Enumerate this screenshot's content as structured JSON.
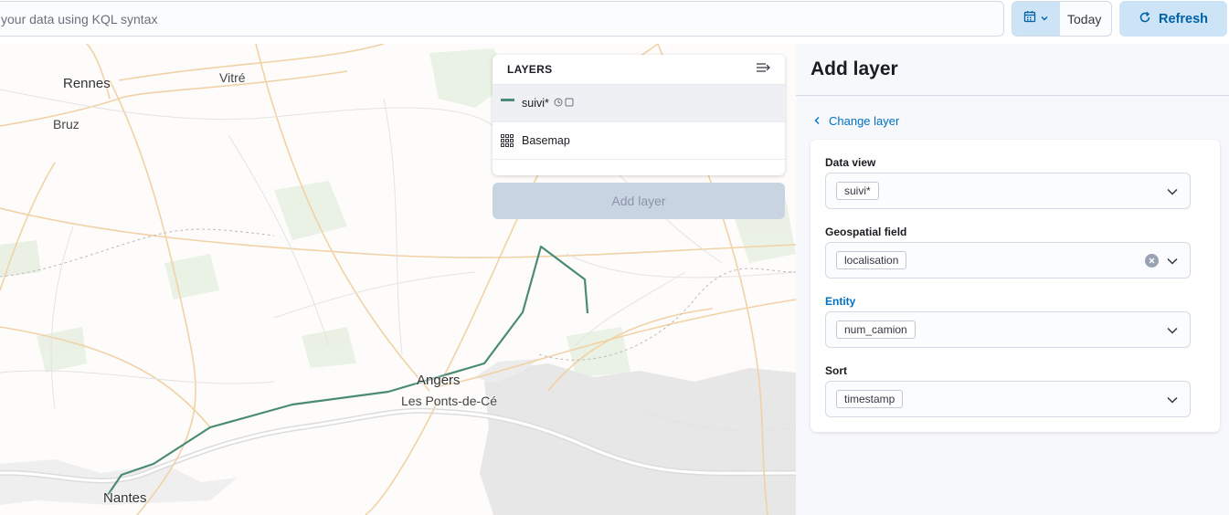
{
  "query_bar": {
    "placeholder": "your data using KQL syntax",
    "date_label": "Today",
    "refresh_label": "Refresh"
  },
  "map": {
    "cities": [
      {
        "name": "Rennes"
      },
      {
        "name": "Vitré"
      },
      {
        "name": "Bruz"
      },
      {
        "name": "Angers"
      },
      {
        "name": "Les Ponts-de-Cé"
      },
      {
        "name": "Nantes"
      }
    ]
  },
  "layers_panel": {
    "title": "LAYERS",
    "layers": [
      {
        "name": "suivi*",
        "icon": "line-swatch"
      },
      {
        "name": "Basemap",
        "icon": "grid-icon"
      }
    ],
    "add_layer_label": "Add layer"
  },
  "right_panel": {
    "title": "Add layer",
    "back_link": "Change layer",
    "fields": [
      {
        "label": "Data view",
        "value": "suivi*"
      },
      {
        "label": "Geospatial field",
        "value": "localisation"
      },
      {
        "label": "Entity",
        "value": "num_camion"
      },
      {
        "label": "Sort",
        "value": "timestamp"
      }
    ]
  },
  "colors": {
    "accent": "#0071c2",
    "track_line": "#4a8b74",
    "refresh_bg": "#cce4f5"
  }
}
